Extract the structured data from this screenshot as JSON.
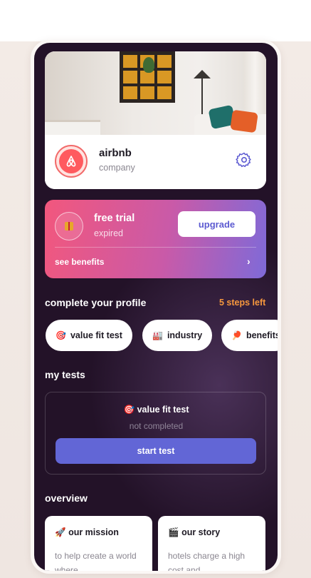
{
  "company": {
    "name": "airbnb",
    "type": "company",
    "brand_color": "#ff5a5f"
  },
  "trial": {
    "title": "free trial",
    "status": "expired",
    "upgrade_label": "upgrade",
    "benefits_label": "see benefits",
    "gradient": [
      "#f2577d",
      "#c95aa8",
      "#7f6ad8"
    ]
  },
  "profile": {
    "title": "complete your profile",
    "steps_left": "5 steps left",
    "chips": [
      {
        "emoji": "🎯",
        "label": "value fit test"
      },
      {
        "emoji": "🏭",
        "label": "industry"
      },
      {
        "emoji": "🏓",
        "label": "benefits"
      }
    ]
  },
  "tests": {
    "title": "my tests",
    "test_emoji": "🎯",
    "test_name": "value fit test",
    "test_status": "not completed",
    "start_label": "start test",
    "accent": "#6266d6"
  },
  "overview": {
    "title": "overview",
    "cards": [
      {
        "emoji": "🚀",
        "title": "our mission",
        "text": "to help create a world where"
      },
      {
        "emoji": "🎬",
        "title": "our story",
        "text": "hotels charge a high cost and"
      }
    ]
  },
  "theme": {
    "background": "#231228",
    "warning": "#f7983e"
  }
}
